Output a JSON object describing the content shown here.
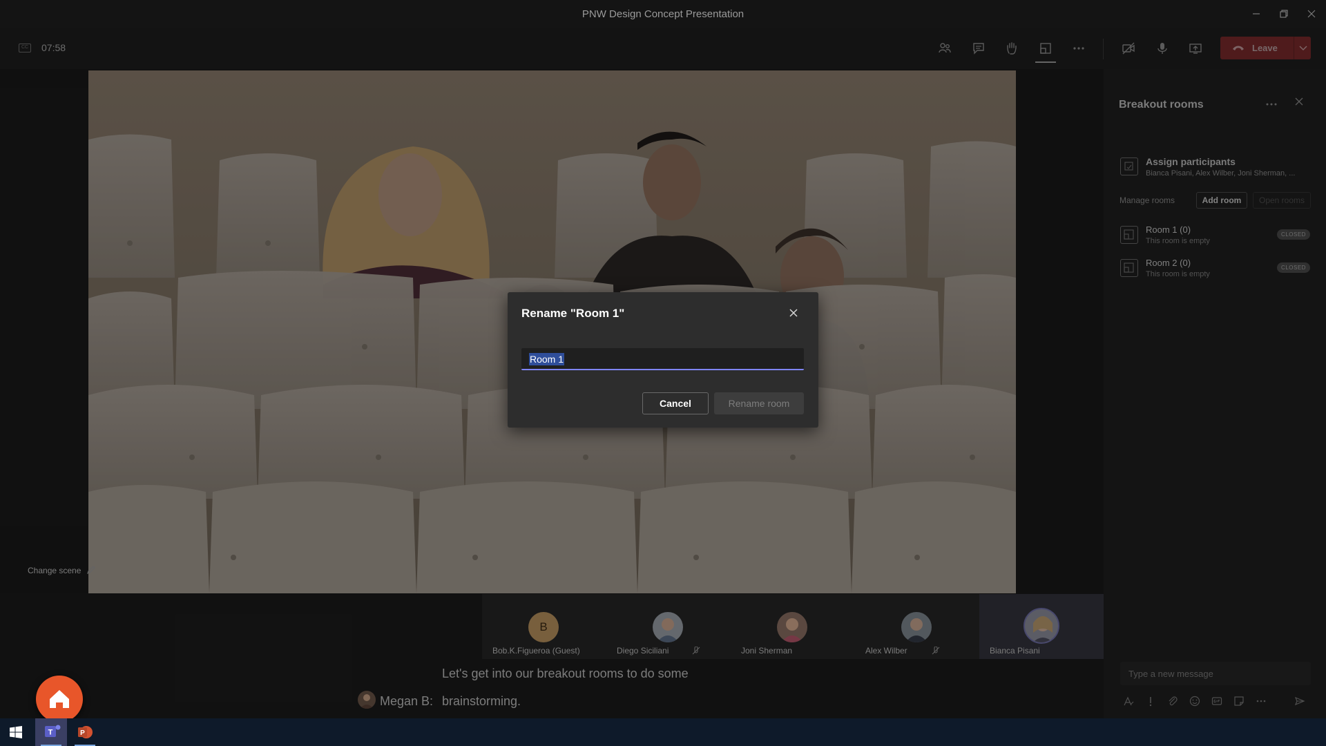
{
  "window": {
    "title": "PNW Design Concept Presentation"
  },
  "callbar": {
    "timer": "07:58",
    "leave_label": "Leave"
  },
  "stage": {
    "change_scene_label": "Change scene"
  },
  "participants": [
    {
      "name": "Bob.K.Figueroa (Guest)",
      "initial": "B",
      "muted": false
    },
    {
      "name": "Diego Siciliani",
      "initial": "",
      "muted": true
    },
    {
      "name": "Joni Sherman",
      "initial": "",
      "muted": false
    },
    {
      "name": "Alex Wilber",
      "initial": "",
      "muted": true
    },
    {
      "name": "Bianca Pisani",
      "initial": "",
      "muted": false,
      "active": true
    }
  ],
  "captions": {
    "line1": "Let's get into our breakout rooms to do some",
    "speaker": "Megan B:",
    "line2": "brainstorming."
  },
  "panel": {
    "title": "Breakout rooms",
    "assign_title": "Assign participants",
    "assign_sub": "Bianca Pisani, Alex Wilber, Joni Sherman, ...",
    "manage_label": "Manage rooms",
    "add_room_label": "Add room",
    "open_rooms_label": "Open rooms",
    "rooms": [
      {
        "name": "Room 1 (0)",
        "sub": "This room is empty",
        "status": "CLOSED"
      },
      {
        "name": "Room 2 (0)",
        "sub": "This room is empty",
        "status": "CLOSED"
      }
    ],
    "message_placeholder": "Type a new message"
  },
  "modal": {
    "title": "Rename \"Room 1\"",
    "input_value": "Room 1",
    "cancel_label": "Cancel",
    "rename_label": "Rename room"
  },
  "colors": {
    "accent": "#7f85f5",
    "leave": "#7a2a2c",
    "home_fab": "#e8562a"
  }
}
